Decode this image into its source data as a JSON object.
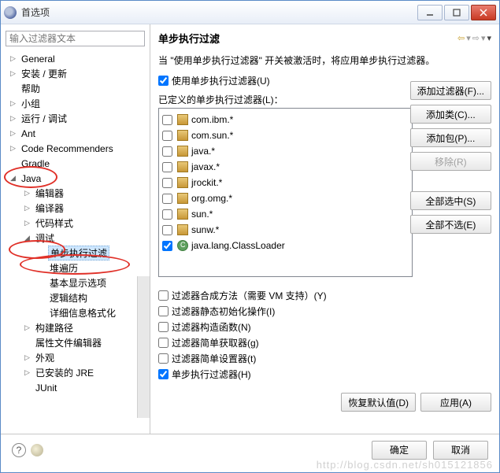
{
  "window": {
    "title": "首选项"
  },
  "search": {
    "placeholder": "输入过滤器文本"
  },
  "tree": [
    {
      "label": "General",
      "arrow": "▷",
      "indent": 0
    },
    {
      "label": "安装 / 更新",
      "arrow": "▷",
      "indent": 0
    },
    {
      "label": "帮助",
      "arrow": "",
      "indent": 0
    },
    {
      "label": "小组",
      "arrow": "▷",
      "indent": 0
    },
    {
      "label": "运行 / 调试",
      "arrow": "▷",
      "indent": 0
    },
    {
      "label": "Ant",
      "arrow": "▷",
      "indent": 0
    },
    {
      "label": "Code Recommenders",
      "arrow": "▷",
      "indent": 0
    },
    {
      "label": "Gradle",
      "arrow": "",
      "indent": 0
    },
    {
      "label": "Java",
      "arrow": "◢",
      "indent": 0
    },
    {
      "label": "编辑器",
      "arrow": "▷",
      "indent": 1
    },
    {
      "label": "编译器",
      "arrow": "▷",
      "indent": 1
    },
    {
      "label": "代码样式",
      "arrow": "▷",
      "indent": 1
    },
    {
      "label": "调试",
      "arrow": "◢",
      "indent": 1
    },
    {
      "label": "单步执行过滤",
      "arrow": "",
      "indent": 2,
      "sel": true
    },
    {
      "label": "堆遍历",
      "arrow": "",
      "indent": 2
    },
    {
      "label": "基本显示选项",
      "arrow": "",
      "indent": 2
    },
    {
      "label": "逻辑结构",
      "arrow": "",
      "indent": 2
    },
    {
      "label": "详细信息格式化",
      "arrow": "",
      "indent": 2
    },
    {
      "label": "构建路径",
      "arrow": "▷",
      "indent": 1
    },
    {
      "label": "属性文件编辑器",
      "arrow": "",
      "indent": 1
    },
    {
      "label": "外观",
      "arrow": "▷",
      "indent": 1
    },
    {
      "label": "已安装的 JRE",
      "arrow": "▷",
      "indent": 1
    },
    {
      "label": "JUnit",
      "arrow": "",
      "indent": 1
    }
  ],
  "page": {
    "title": "单步执行过滤",
    "desc": "当 \"使用单步执行过滤器\" 开关被激活时，将应用单步执行过滤器。",
    "use_filter": "使用单步执行过滤器(U)",
    "defined": "已定义的单步执行过滤器(L)："
  },
  "filters": [
    {
      "label": "com.ibm.*",
      "type": "pkg",
      "checked": false
    },
    {
      "label": "com.sun.*",
      "type": "pkg",
      "checked": false
    },
    {
      "label": "java.*",
      "type": "pkg",
      "checked": false
    },
    {
      "label": "javax.*",
      "type": "pkg",
      "checked": false
    },
    {
      "label": "jrockit.*",
      "type": "pkg",
      "checked": false
    },
    {
      "label": "org.omg.*",
      "type": "pkg",
      "checked": false
    },
    {
      "label": "sun.*",
      "type": "pkg",
      "checked": false
    },
    {
      "label": "sunw.*",
      "type": "pkg",
      "checked": false
    },
    {
      "label": "java.lang.ClassLoader",
      "type": "cls",
      "checked": true
    }
  ],
  "sidebtns": {
    "add_filter": "添加过滤器(F)...",
    "add_class": "添加类(C)...",
    "add_pkg": "添加包(P)...",
    "remove": "移除(R)",
    "select_all": "全部选中(S)",
    "deselect_all": "全部不选(E)"
  },
  "options": [
    {
      "label": "过滤器合成方法（需要 VM 支持）(Y)",
      "checked": false
    },
    {
      "label": "过滤器静态初始化操作(I)",
      "checked": false
    },
    {
      "label": "过滤器构造函数(N)",
      "checked": false
    },
    {
      "label": "过滤器简单获取器(g)",
      "checked": false
    },
    {
      "label": "过滤器简单设置器(t)",
      "checked": false
    },
    {
      "label": "单步执行过滤器(H)",
      "checked": true
    }
  ],
  "bottom": {
    "restore": "恢复默认值(D)",
    "apply": "应用(A)"
  },
  "footer": {
    "ok": "确定",
    "cancel": "取消"
  },
  "watermark": "http://blog.csdn.net/sh015121856"
}
